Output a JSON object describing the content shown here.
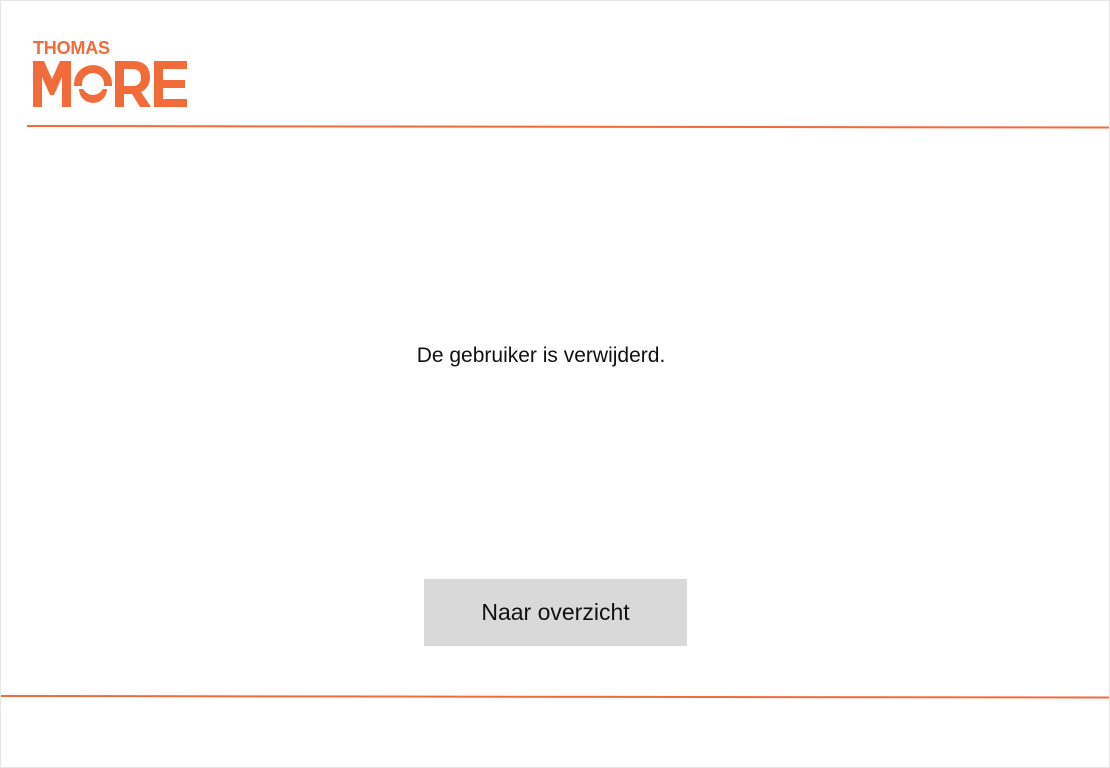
{
  "brand": {
    "logo_top": "THOMAS",
    "logo_bottom": "MORE",
    "accent_color": "#f26b3a"
  },
  "main": {
    "message": "De gebruiker is verwijderd.",
    "overview_button_label": "Naar overzicht"
  },
  "icons": {
    "logo": "thomas-more-logo"
  }
}
